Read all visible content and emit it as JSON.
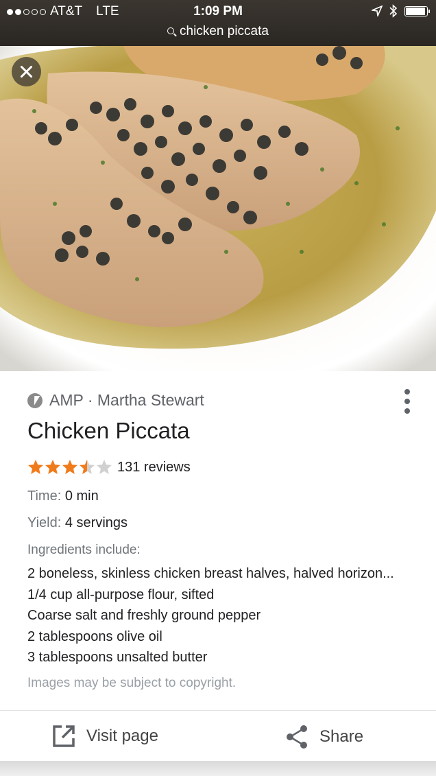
{
  "status_bar": {
    "carrier": "AT&T",
    "network": "LTE",
    "time": "1:09 PM",
    "signal_bars_filled": 2,
    "signal_bars_total": 5,
    "battery_level": 0.95
  },
  "url_bar": {
    "query": "chicken piccata",
    "icon": "search-icon"
  },
  "result": {
    "source_icon": "amp-lightning-icon",
    "source": "AMP · Martha Stewart",
    "title": "Chicken Piccata",
    "rating": 3.5,
    "rating_max": 5,
    "reviews": "131 reviews",
    "time_label": "Time:",
    "time_value": "0 min",
    "yield_label": "Yield:",
    "yield_value": "4 servings",
    "ingredients_heading": "Ingredients include:",
    "ingredients": [
      "2 boneless, skinless chicken breast halves, halved horizon...",
      "1/4 cup all-purpose flour, sifted",
      "Coarse salt and freshly ground pepper",
      "2 tablespoons olive oil",
      "3 tablespoons unsalted butter"
    ],
    "copyright": "Images may be subject to copyright."
  },
  "actions": {
    "visit_label": "Visit page",
    "share_label": "Share"
  },
  "colors": {
    "star": "#f07b1a",
    "star_empty": "#d0d0d0",
    "status_bar": "#2f2b27"
  }
}
